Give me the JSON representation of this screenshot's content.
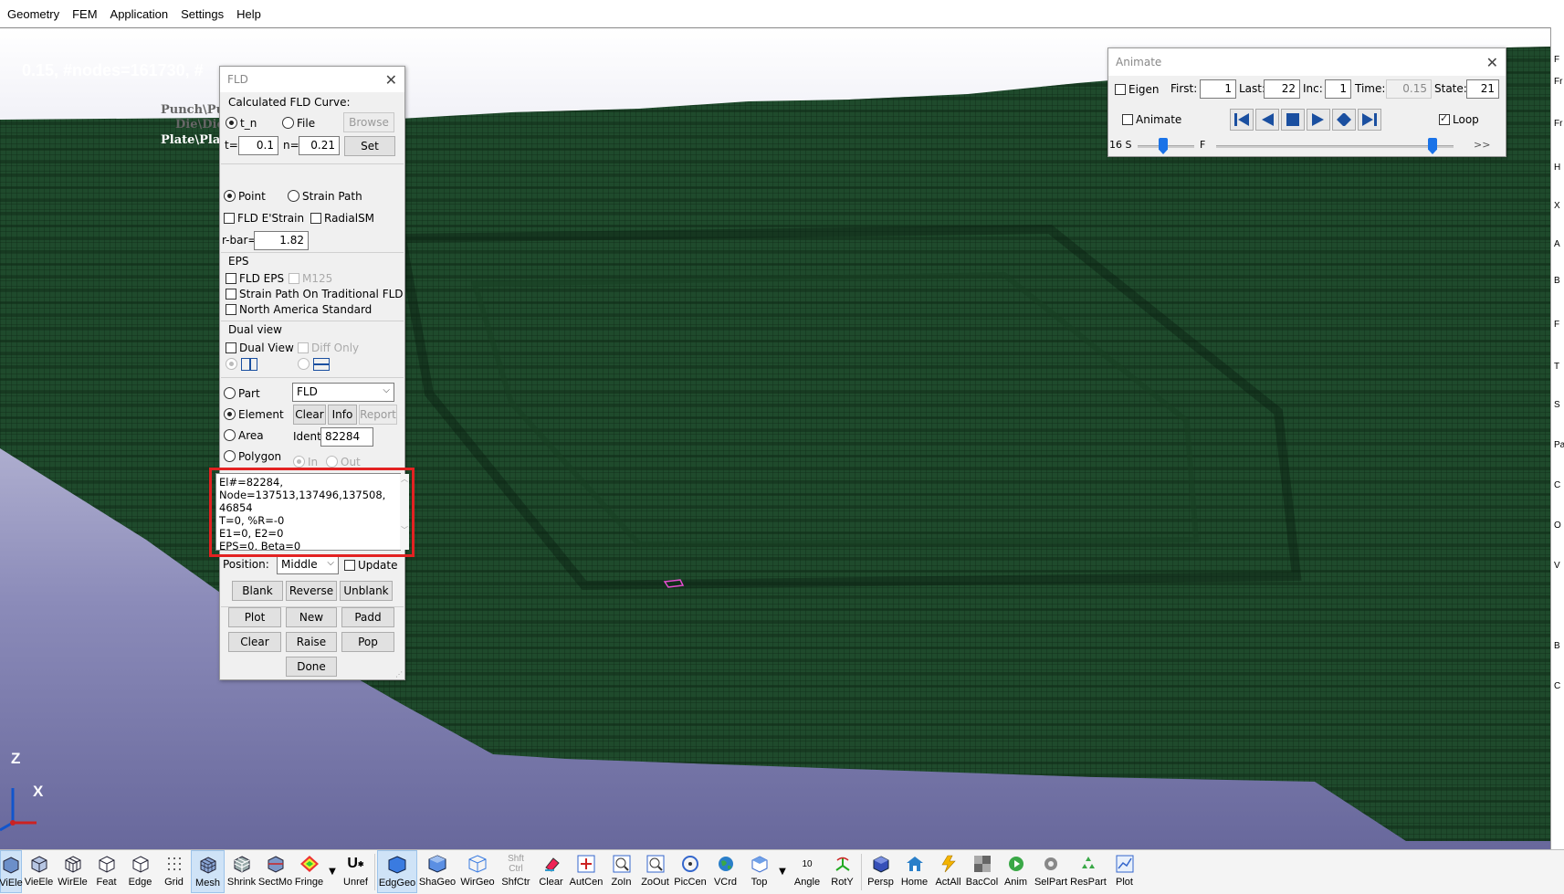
{
  "menu": [
    "Geometry",
    "FEM",
    "Application",
    "Settings",
    "Help"
  ],
  "viewport": {
    "title_text": "0.15, #nodes=161730, #",
    "parts": [
      "Punch\\Pu",
      "Die\\Die",
      "Plate\\Plat"
    ],
    "axis_z": "Z",
    "axis_x": "X"
  },
  "right_strip_chars": [
    "F",
    "Fr",
    "Fr",
    "H",
    "X",
    "A",
    "B",
    "F",
    "T",
    "S",
    "Pa",
    "C",
    "O",
    "V",
    "B",
    "C"
  ],
  "fld": {
    "title": "FLD",
    "curve_label": "Calculated FLD Curve:",
    "radio_tn": "t_n",
    "radio_file": "File",
    "browse": "Browse",
    "t_label": "t=",
    "t_value": "0.1",
    "n_label": "n=",
    "n_value": "0.21",
    "set": "Set",
    "point": "Point",
    "strain_path": "Strain Path",
    "fld_estrain": "FLD E'Strain",
    "radialsm": "RadialSM",
    "rbar_label": "r-bar=",
    "rbar_value": "1.82",
    "eps_header": "EPS",
    "fld_eps": "FLD EPS",
    "m125": "M125",
    "strain_path_trad": "Strain Path On Traditional FLD",
    "na_standard": "North America Standard",
    "dual_header": "Dual view",
    "dual_view": "Dual View",
    "diff_only": "Diff Only",
    "part": "Part",
    "element": "Element",
    "area": "Area",
    "polygon": "Polygon",
    "select_value": "FLD",
    "clear": "Clear",
    "info": "Info",
    "report": "Report",
    "ident_label": "Ident",
    "ident_value": "82284",
    "in": "In",
    "out": "Out",
    "info_text": "El#=82284,\nNode=137513,137496,137508,\n46854\nT=0, %R=-0\nE1=0, E2=0\nEPS=0, Beta=0",
    "position_label": "Position:",
    "position_value": "Middle",
    "update": "Update",
    "blank": "Blank",
    "reverse": "Reverse",
    "unblank": "Unblank",
    "plot": "Plot",
    "new": "New",
    "padd": "Padd",
    "clear2": "Clear",
    "raise": "Raise",
    "pop": "Pop",
    "done": "Done"
  },
  "animate": {
    "title": "Animate",
    "eigen": "Eigen",
    "first_label": "First:",
    "first_value": "1",
    "last_label": "Last:",
    "last_value": "22",
    "inc_label": "Inc:",
    "inc_value": "1",
    "time_label": "Time:",
    "time_value": "0.15",
    "state_label": "State:",
    "state_value": "21",
    "animate_label": "Animate",
    "loop_label": "Loop",
    "loop_checked": true,
    "speed_label": "16 S",
    "f_label": "F",
    "more": ">>"
  },
  "toolbar": [
    {
      "label": "ViEle",
      "icon": "cube-solid-icon",
      "active": true
    },
    {
      "label": "VieEle",
      "icon": "cube-icon",
      "active": false
    },
    {
      "label": "WirEle",
      "icon": "wire-cube-icon",
      "active": false
    },
    {
      "label": "Feat",
      "icon": "feature-cube-icon",
      "active": false
    },
    {
      "label": "Edge",
      "icon": "edge-cube-icon",
      "active": false
    },
    {
      "label": "Grid",
      "icon": "grid-icon",
      "active": false
    },
    {
      "label": "Mesh",
      "icon": "mesh-icon",
      "active": true
    },
    {
      "label": "Shrink",
      "icon": "shrink-icon",
      "active": false
    },
    {
      "label": "SectMo",
      "icon": "section-icon",
      "active": false
    },
    {
      "label": "Fringe",
      "icon": "fringe-icon",
      "active": false
    },
    {
      "label": "Unref",
      "icon": "unref-icon",
      "active": false
    },
    {
      "label": "EdgGeo",
      "icon": "edge-geo-icon",
      "active": true
    },
    {
      "label": "ShaGeo",
      "icon": "shade-geo-icon",
      "active": false
    },
    {
      "label": "WirGeo",
      "icon": "wire-geo-icon",
      "active": false
    },
    {
      "label": "ShfCtr",
      "icon": "shift-ctrl-icon",
      "active": false
    },
    {
      "label": "Clear",
      "icon": "eraser-icon",
      "active": false
    },
    {
      "label": "AutCen",
      "icon": "auto-center-icon",
      "active": false
    },
    {
      "label": "ZoIn",
      "icon": "zoom-in-icon",
      "active": false
    },
    {
      "label": "ZoOut",
      "icon": "zoom-out-icon",
      "active": false
    },
    {
      "label": "PicCen",
      "icon": "pick-center-icon",
      "active": false
    },
    {
      "label": "VCrd",
      "icon": "globe-icon",
      "active": false
    },
    {
      "label": "Top",
      "icon": "top-view-icon",
      "active": false
    },
    {
      "label": "Angle",
      "icon": "angle-icon",
      "active": false
    },
    {
      "label": "RotY",
      "icon": "rotate-y-icon",
      "active": false
    },
    {
      "label": "Persp",
      "icon": "perspective-icon",
      "active": false
    },
    {
      "label": "Home",
      "icon": "home-icon",
      "active": false
    },
    {
      "label": "ActAll",
      "icon": "activate-all-icon",
      "active": false
    },
    {
      "label": "BacCol",
      "icon": "background-color-icon",
      "active": false
    },
    {
      "label": "Anim",
      "icon": "animate-icon",
      "active": false
    },
    {
      "label": "SelPart",
      "icon": "select-part-icon",
      "active": false
    },
    {
      "label": "ResPart",
      "icon": "restore-part-icon",
      "active": false
    },
    {
      "label": "Plot",
      "icon": "plot-icon",
      "active": false
    }
  ],
  "toolbar_extra": {
    "shift": "Shft",
    "ctrl": "Ctrl",
    "angle_value": "10"
  },
  "colors": {
    "mesh": "#1f4a2c",
    "accent": "#1a73e8",
    "highlight_box": "#e32222"
  }
}
